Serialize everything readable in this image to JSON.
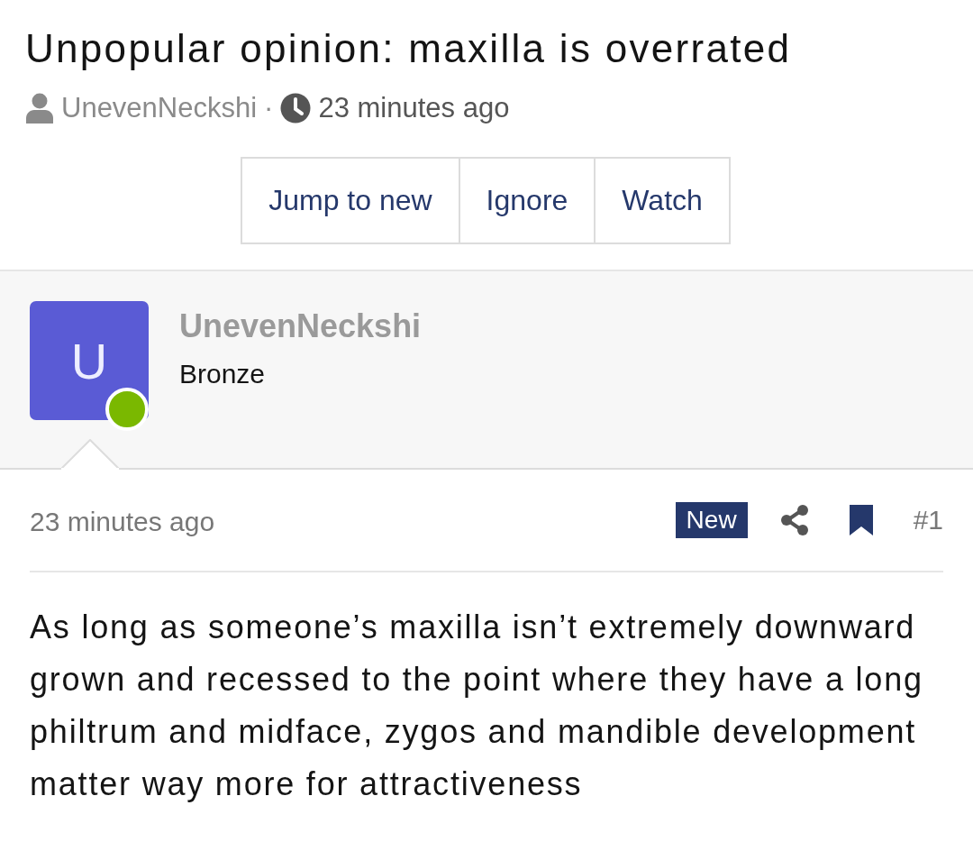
{
  "thread": {
    "title": "Unpopular opinion: maxilla is overrated",
    "author": "UnevenNeckshi",
    "separator": "·",
    "time": "23 minutes ago"
  },
  "actions": [
    {
      "label": "Jump to new"
    },
    {
      "label": "Ignore"
    },
    {
      "label": "Watch"
    }
  ],
  "user": {
    "avatar_letter": "U",
    "name": "UnevenNeckshi",
    "rank": "Bronze",
    "online": true
  },
  "post": {
    "time": "23 minutes ago",
    "badge": "New",
    "number": "#1",
    "body": "As long as someone’s maxilla isn’t extremely downward grown and recessed to the point where they have a long philtrum and midface, zygos and mandible development matter way more for attractiveness"
  }
}
